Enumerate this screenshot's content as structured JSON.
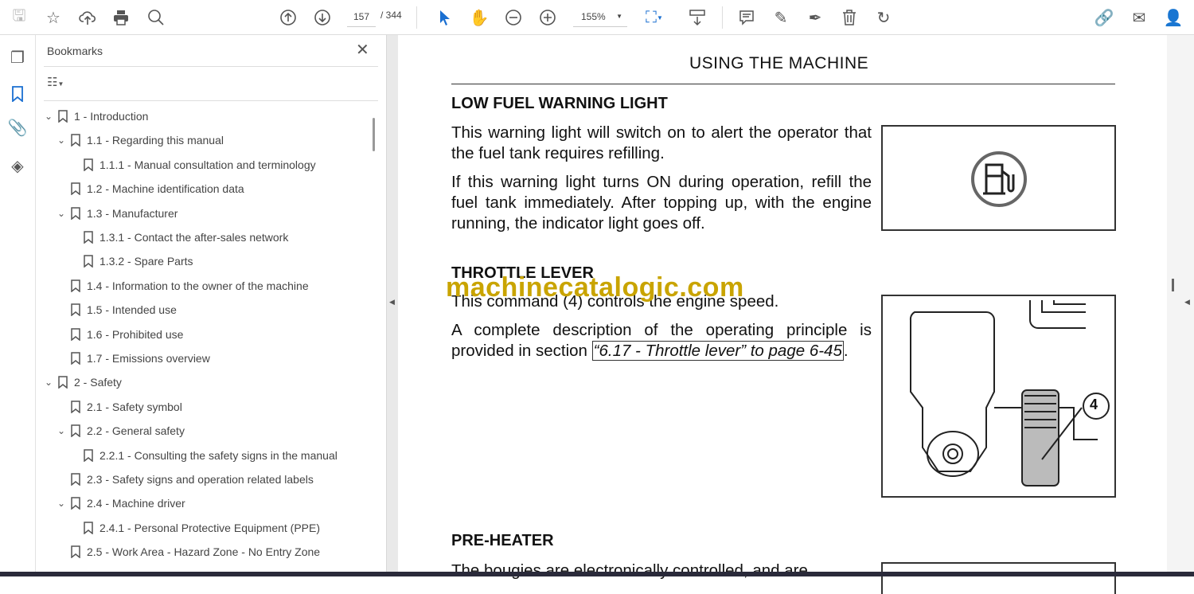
{
  "toolbar": {
    "page_current": "157",
    "page_total": "/ 344",
    "zoom": "155%"
  },
  "bookmarks": {
    "title": "Bookmarks",
    "items": [
      {
        "label": "1  -  Introduction",
        "level": 1,
        "expanded": true
      },
      {
        "label": "1.1 - Regarding this manual",
        "level": 2,
        "expanded": true
      },
      {
        "label": "1.1.1 - Manual consultation and terminology",
        "level": 3
      },
      {
        "label": "1.2 - Machine identification data",
        "level": 2
      },
      {
        "label": "1.3 - Manufacturer",
        "level": 2,
        "expanded": true
      },
      {
        "label": "1.3.1 - Contact the after-sales network",
        "level": 3
      },
      {
        "label": "1.3.2 - Spare Parts",
        "level": 3
      },
      {
        "label": "1.4 - Information to the owner of the machine",
        "level": 2
      },
      {
        "label": "1.5 - Intended use",
        "level": 2
      },
      {
        "label": "1.6 - Prohibited use",
        "level": 2
      },
      {
        "label": "1.7 - Emissions overview",
        "level": 2
      },
      {
        "label": "2  -  Safety",
        "level": 1,
        "expanded": true
      },
      {
        "label": "2.1 - Safety symbol",
        "level": 2
      },
      {
        "label": "2.2 - General safety",
        "level": 2,
        "expanded": true
      },
      {
        "label": "2.2.1 - Consulting the safety signs in the manual",
        "level": 3
      },
      {
        "label": "2.3 - Safety signs and operation related labels",
        "level": 2
      },
      {
        "label": "2.4 - Machine driver",
        "level": 2,
        "expanded": true
      },
      {
        "label": "2.4.1 - Personal Protective Equipment (PPE)",
        "level": 3
      },
      {
        "label": "2.5 - Work Area - Hazard Zone - No Entry Zone",
        "level": 2
      }
    ]
  },
  "document": {
    "header": "USING THE MACHINE",
    "s1_title": "LOW FUEL WARNING LIGHT",
    "s1_p1": "This warning light will switch on to alert the operator that the fuel tank requires refilling.",
    "s1_p2": "If this warning light turns ON during operation, refill the fuel tank immediately. After topping up, with the engine running, the indicator light goes off.",
    "s2_title": "THROTTLE LEVER",
    "s2_p1": "This command (4) controls the engine speed.",
    "s2_p2_pre": "A complete description of the operating principle is provided in section ",
    "s2_p2_link": "“6.17 - Throttle lever” to page 6-45",
    "s2_p2_post": ".",
    "callout": "4",
    "s3_title": "PRE-HEATER",
    "s3_p1": "The bougies are electronically controlled, and are",
    "watermark": "machinecatalogic.com"
  }
}
